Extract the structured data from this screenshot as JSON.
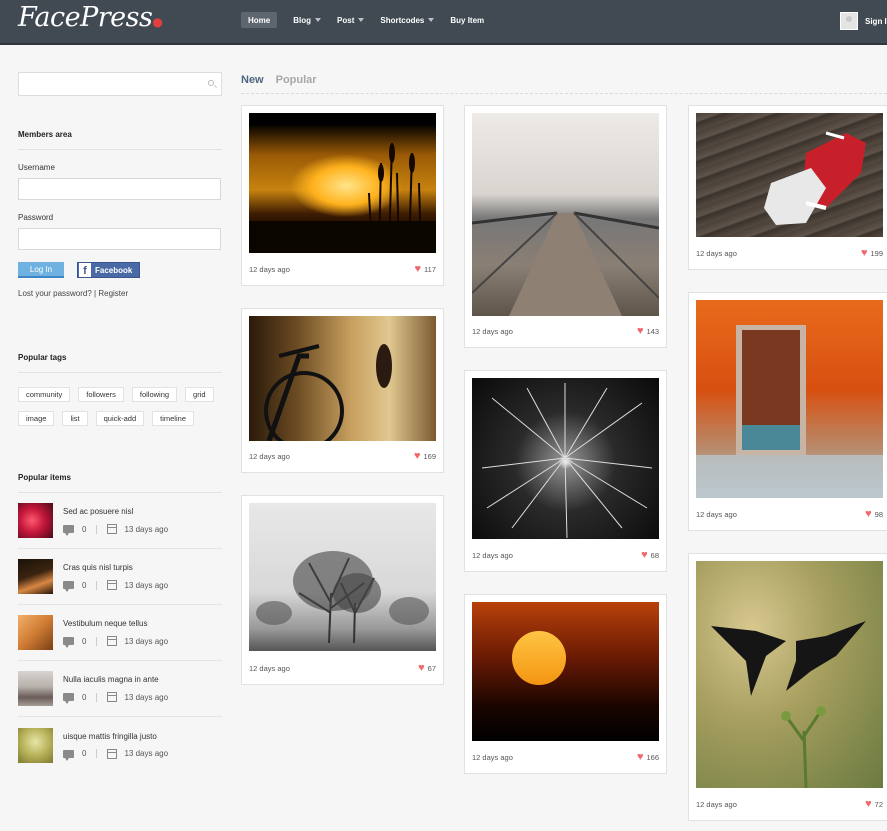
{
  "header": {
    "logo": "FacePress",
    "nav": [
      {
        "label": "Home",
        "active": true,
        "dropdown": false
      },
      {
        "label": "Blog",
        "active": false,
        "dropdown": true
      },
      {
        "label": "Post",
        "active": false,
        "dropdown": true
      },
      {
        "label": "Shortcodes",
        "active": false,
        "dropdown": true
      },
      {
        "label": "Buy Item",
        "active": false,
        "dropdown": false
      }
    ],
    "signin_label": "Sign In"
  },
  "sidebar": {
    "search_placeholder": "",
    "members": {
      "title": "Members area",
      "username_label": "Username",
      "password_label": "Password",
      "login_button": "Log In",
      "facebook_button": "Facebook",
      "lost_password": "Lost your password? | Register"
    },
    "tags": {
      "title": "Popular tags",
      "items": [
        "community",
        "followers",
        "following",
        "grid",
        "image",
        "list",
        "quick-add",
        "timeline"
      ]
    },
    "popular": {
      "title": "Popular items",
      "items": [
        {
          "title": "Sed ac posuere nisl",
          "comments": "0",
          "date": "13 days ago"
        },
        {
          "title": "Cras quis nisl turpis",
          "comments": "0",
          "date": "13 days ago"
        },
        {
          "title": "Vestibulum neque tellus",
          "comments": "0",
          "date": "13 days ago"
        },
        {
          "title": "Nulla iaculis magna in ante",
          "comments": "0",
          "date": "13 days ago"
        },
        {
          "title": "uisque mattis fringilla justo",
          "comments": "0",
          "date": "13 days ago"
        }
      ]
    }
  },
  "main": {
    "tabs": [
      {
        "label": "New",
        "active": true
      },
      {
        "label": "Popular",
        "active": false
      }
    ],
    "posts": [
      {
        "image": "sunset-reeds-photo",
        "date": "12 days ago",
        "likes": "117"
      },
      {
        "image": "bicycle-street-photo",
        "date": "12 days ago",
        "likes": "169"
      },
      {
        "image": "winter-trees-photo",
        "date": "12 days ago",
        "likes": "67"
      },
      {
        "image": "boardwalk-bridge-photo",
        "date": "12 days ago",
        "likes": "143"
      },
      {
        "image": "dandelion-photo",
        "date": "12 days ago",
        "likes": "68"
      },
      {
        "image": "red-sun-photo",
        "date": "12 days ago",
        "likes": "166"
      },
      {
        "image": "sneakers-photo",
        "date": "12 days ago",
        "likes": "199"
      },
      {
        "image": "orange-door-photo",
        "date": "12 days ago",
        "likes": "98"
      },
      {
        "image": "birds-fighting-photo",
        "date": "12 days ago",
        "likes": "72"
      }
    ]
  },
  "colors": {
    "header_bg": "#414a53",
    "accent_blue": "#6fb2e2",
    "heart": "#f0686c",
    "tab_active": "#4c6680"
  }
}
